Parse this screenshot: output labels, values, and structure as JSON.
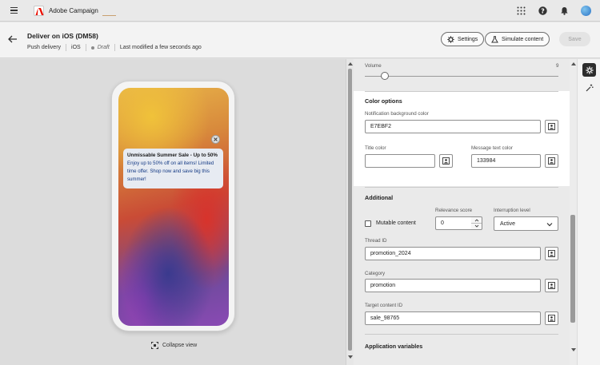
{
  "app": {
    "name": "Adobe Campaign"
  },
  "header": {
    "title": "Deliver on iOS (DM58)",
    "channel": "Push delivery",
    "platform": "iOS",
    "status": "Draft",
    "last_modified": "Last modified a few seconds ago",
    "settings_label": "Settings",
    "simulate_label": "Simulate content",
    "save_label": "Save"
  },
  "preview": {
    "notification": {
      "title": "Unmissable Summer Sale - Up to 50% ...",
      "body": "Enjoy up to 50% off on all items! Limited time offer. Shop now and save big this summer!",
      "background_color": "#E7EBF2",
      "text_color": "#133984"
    },
    "collapse_label": "Collapse view"
  },
  "panel": {
    "volume": {
      "label": "Volume",
      "value": "9"
    },
    "color_options": {
      "title": "Color options",
      "notification_bg_label": "Notification background color",
      "notification_bg_value": "E7EBF2",
      "title_color_label": "Title color",
      "title_color_value": "",
      "message_color_label": "Message text color",
      "message_color_value": "133984"
    },
    "additional": {
      "title": "Additional",
      "mutable_label": "Mutable content",
      "relevance_label": "Relevance score",
      "relevance_value": "0",
      "interruption_label": "Interruption level",
      "interruption_value": "Active",
      "thread_label": "Thread ID",
      "thread_value": "promotion_2024",
      "category_label": "Category",
      "category_value": "promotion",
      "target_label": "Target content ID",
      "target_value": "sale_98765"
    },
    "app_vars_title": "Application variables"
  },
  "colors": {
    "accent": "#1473e6",
    "rail_active": "#2c2c2c",
    "adobe_red": "#eb1000"
  }
}
